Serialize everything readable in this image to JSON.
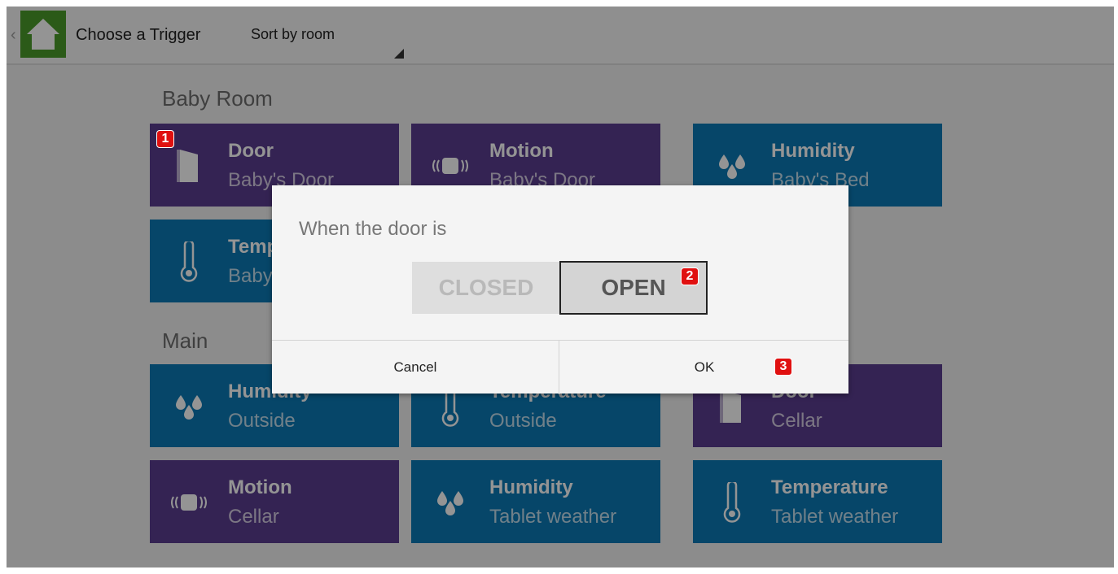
{
  "header": {
    "title": "Choose a Trigger",
    "sort_label": "Sort by room"
  },
  "sections": [
    {
      "title": "Baby Room",
      "tiles": [
        {
          "name": "Door",
          "sub": "Baby's Door",
          "icon": "door-icon",
          "color": "#5b3d8f"
        },
        {
          "name": "Motion",
          "sub": "Baby's Door",
          "icon": "motion-icon",
          "color": "#5b3d8f"
        },
        {
          "name": "Humidity",
          "sub": "Baby's Bed",
          "icon": "humidity-icon",
          "color": "#0b79b5"
        },
        {
          "name": "Temperature",
          "sub": "Baby's Bed",
          "icon": "thermometer-icon",
          "color": "#0b79b5"
        }
      ]
    },
    {
      "title": "Main",
      "tiles": [
        {
          "name": "Humidity",
          "sub": "Outside",
          "icon": "humidity-icon",
          "color": "#0b79b5"
        },
        {
          "name": "Temperature",
          "sub": "Outside",
          "icon": "thermometer-icon",
          "color": "#0b79b5"
        },
        {
          "name": "Door",
          "sub": "Cellar",
          "icon": "door-icon",
          "color": "#5b3d8f"
        },
        {
          "name": "Motion",
          "sub": "Cellar",
          "icon": "motion-icon",
          "color": "#5b3d8f"
        },
        {
          "name": "Humidity",
          "sub": "Tablet weather",
          "icon": "humidity-icon",
          "color": "#0b79b5"
        },
        {
          "name": "Temperature",
          "sub": "Tablet weather",
          "icon": "thermometer-icon",
          "color": "#0b79b5"
        }
      ]
    }
  ],
  "dialog": {
    "message": "When the door is",
    "option_closed": "CLOSED",
    "option_open": "OPEN",
    "selected": "OPEN",
    "cancel_label": "Cancel",
    "ok_label": "OK"
  },
  "annotations": [
    "1",
    "2",
    "3"
  ],
  "colors": {
    "purple_tile": "#5b3d8f",
    "blue_tile": "#0b79b5",
    "app_icon_green": "#4a9b2a",
    "badge_red": "#e01010"
  }
}
